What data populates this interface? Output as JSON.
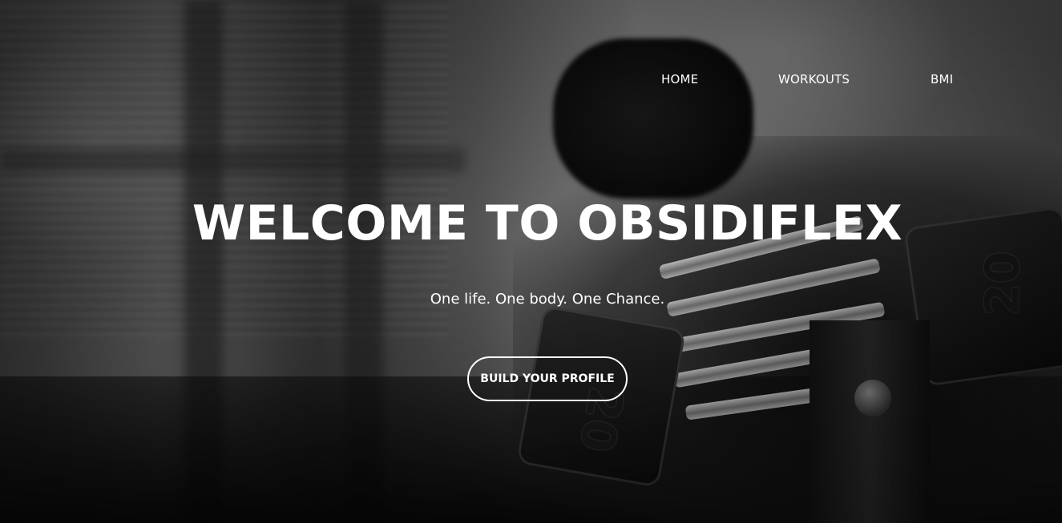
{
  "nav": {
    "items": [
      {
        "label": "HOME"
      },
      {
        "label": "WORKOUTS"
      },
      {
        "label": "BMI"
      }
    ]
  },
  "hero": {
    "title": "WELCOME TO OBSIDIFLEX",
    "subtitle": "One life. One body. One Chance.",
    "cta_label": "BUILD YOUR PROFILE",
    "dumbbell_labels": [
      "20",
      "20"
    ]
  },
  "colors": {
    "text": "#ffffff",
    "overlay": "#000000"
  }
}
